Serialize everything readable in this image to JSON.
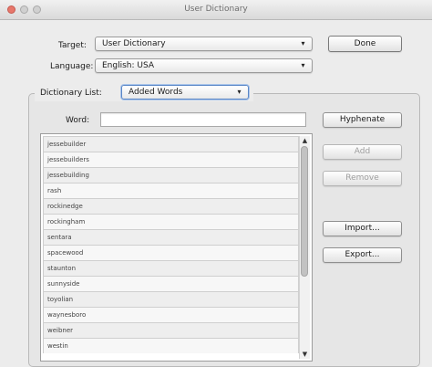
{
  "window": {
    "title": "User Dictionary"
  },
  "target": {
    "label": "Target:",
    "value": "User Dictionary"
  },
  "language": {
    "label": "Language:",
    "value": "English: USA"
  },
  "done_button": "Done",
  "dictionary_list": {
    "label": "Dictionary List:",
    "value": "Added Words"
  },
  "word": {
    "label": "Word:",
    "value": ""
  },
  "buttons": {
    "hyphenate": "Hyphenate",
    "add": "Add",
    "remove": "Remove",
    "import": "Import...",
    "export": "Export..."
  },
  "words": [
    "jessebuilder",
    "jessebuilders",
    "jessebuilding",
    "rash",
    "rockinedge",
    "rockingham",
    "sentara",
    "spacewood",
    "staunton",
    "sunnyside",
    "toyolian",
    "waynesboro",
    "weibner",
    "westin"
  ],
  "icons": {
    "popup_arrow": "▾",
    "scroll_up": "▲",
    "scroll_down": "▼"
  }
}
